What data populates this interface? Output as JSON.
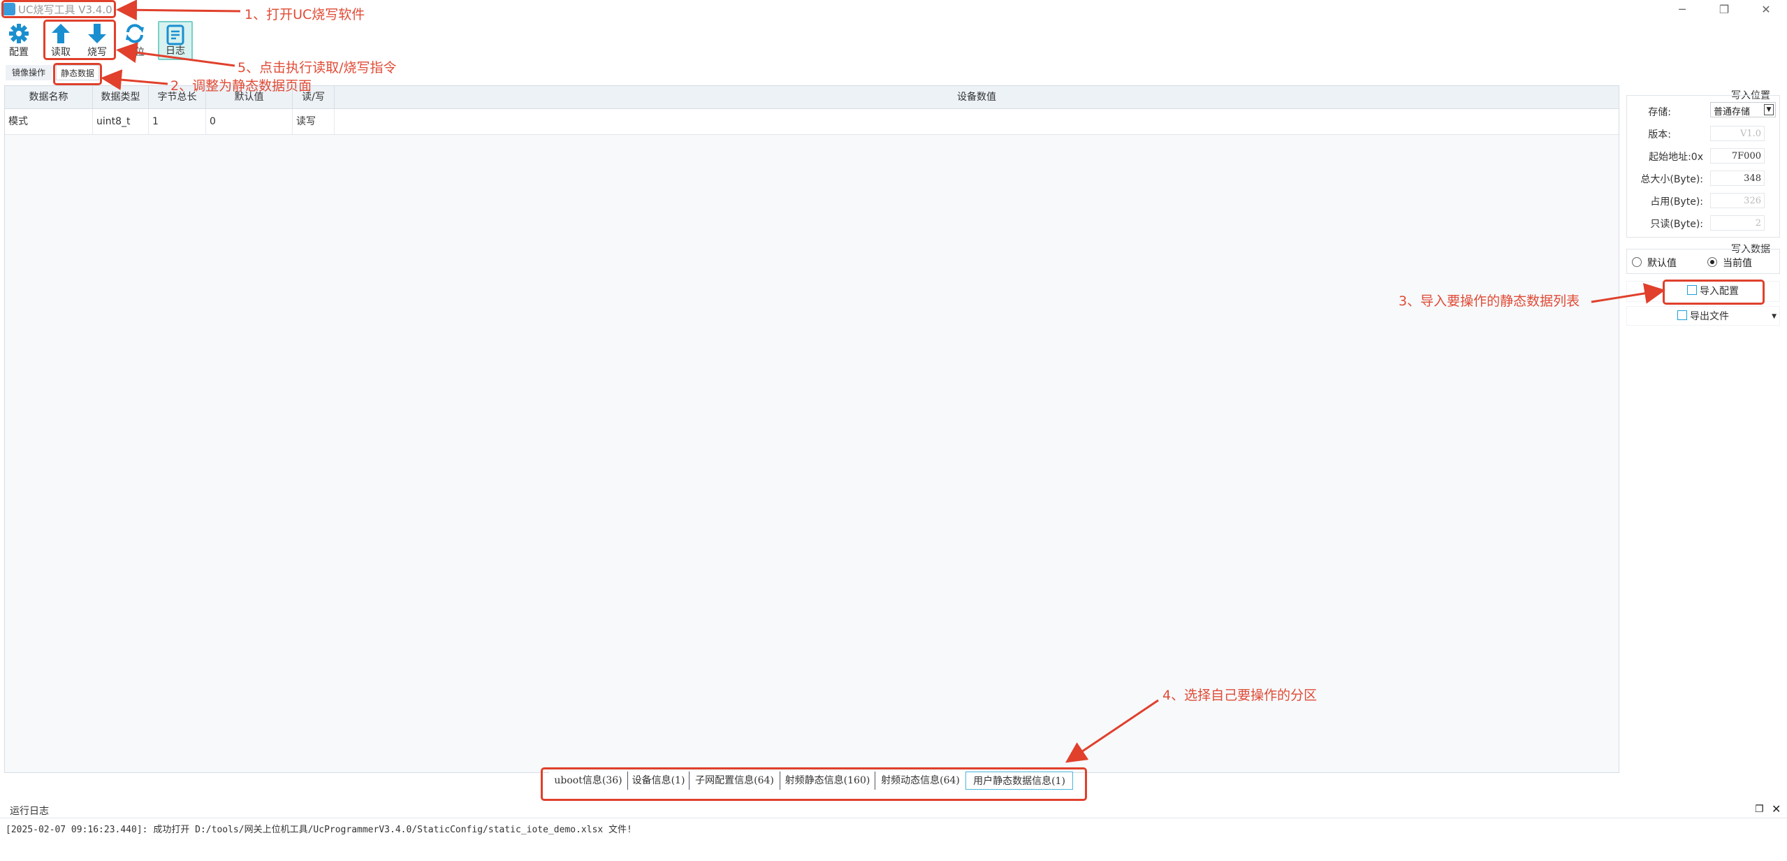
{
  "window": {
    "title": "UC烧写工具 V3.4.0",
    "controls": {
      "minimize": "─",
      "restore": "❐",
      "close": "✕"
    }
  },
  "toolbar": {
    "config_label": "配置",
    "read_label": "读取",
    "write_label": "烧写",
    "reset_label": "复位",
    "log_label": "日志"
  },
  "page_tabs": {
    "image_op": "镜像操作",
    "static_data": "静态数据"
  },
  "grid": {
    "columns": [
      "数据名称",
      "数据类型",
      "字节总长",
      "默认值",
      "读/写",
      "设备数值"
    ],
    "rows": [
      {
        "name": "模式",
        "type": "uint8_t",
        "length": "1",
        "default": "0",
        "rw": "读写",
        "device_value": ""
      }
    ]
  },
  "write_position": {
    "section_title": "写入位置",
    "storage_label": "存储:",
    "storage_value": "普通存储",
    "version_label": "版本:",
    "version_value": "V1.0",
    "start_addr_label": "起始地址:0x",
    "start_addr_value": "7F000",
    "total_size_label": "总大小(Byte):",
    "total_size_value": "348",
    "used_label": "占用(Byte):",
    "used_value": "326",
    "readonly_label": "只读(Byte):",
    "readonly_value": "2"
  },
  "write_data": {
    "section_title": "写入数据",
    "default_option": "默认值",
    "current_option": "当前值",
    "selected": "当前值"
  },
  "actions": {
    "import_label": "导入配置",
    "export_label": "导出文件"
  },
  "partitions": [
    "uboot信息(36)",
    "设备信息(1)",
    "子网配置信息(64)",
    "射频静态信息(160)",
    "射频动态信息(64)",
    "用户静态数据信息(1)"
  ],
  "log": {
    "title": "运行日志",
    "lines": [
      "[2025-02-07 09:16:23.440]: 成功打开 D:/tools/网关上位机工具/UcProgrammerV3.4.0/StaticConfig/static_iote_demo.xlsx 文件!"
    ]
  },
  "annotations": {
    "step1": "1、打开UC烧写软件",
    "step2": "2、调整为静态数据页面",
    "step3": "3、导入要操作的静态数据列表",
    "step4": "4、选择自己要操作的分区",
    "step5": "5、点击执行读取/烧写指令"
  },
  "colors": {
    "accent": "#1aa0d8",
    "annotation": "#e0402c",
    "log_active": "#d7f2f0"
  }
}
